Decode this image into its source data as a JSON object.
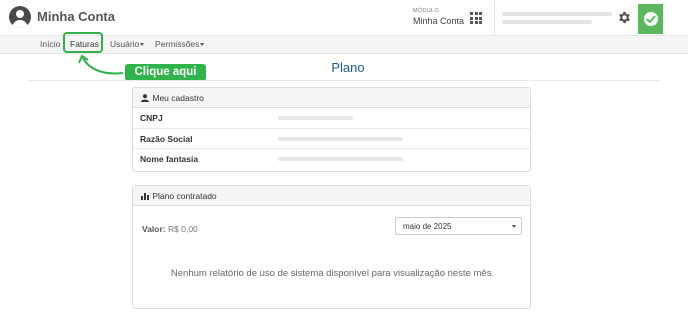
{
  "header": {
    "app_title": "Minha Conta",
    "module_label": "MÓDULO",
    "module_name": "Minha Conta",
    "avatar_icon": "user-avatar-icon",
    "apps_icon": "grid-icon",
    "settings_icon": "gear-icon",
    "status_icon": "check-circle-icon",
    "status_color": "#5cb85c"
  },
  "nav": {
    "items": [
      {
        "label": "Início"
      },
      {
        "label": "Faturas"
      },
      {
        "label": "Usuário"
      },
      {
        "label": "Permissões"
      }
    ]
  },
  "annotation": {
    "callout_text": "Clique aqui",
    "highlight_color": "#2fb34a"
  },
  "page": {
    "title": "Plano"
  },
  "cadastro": {
    "heading": "Meu cadastro",
    "heading_icon": "user-icon",
    "rows": [
      {
        "label": "CNPJ"
      },
      {
        "label": "Razão Social"
      },
      {
        "label": "Nome fantasia"
      }
    ]
  },
  "plano": {
    "heading": "Plano contratado",
    "heading_icon": "bar-chart-icon",
    "valor_label": "Valor:",
    "valor_value": "R$ 0,00",
    "month_select": "maio de 2025",
    "empty_message": "Nenhum relatório de uso de sistema disponível para visualização neste mês."
  }
}
